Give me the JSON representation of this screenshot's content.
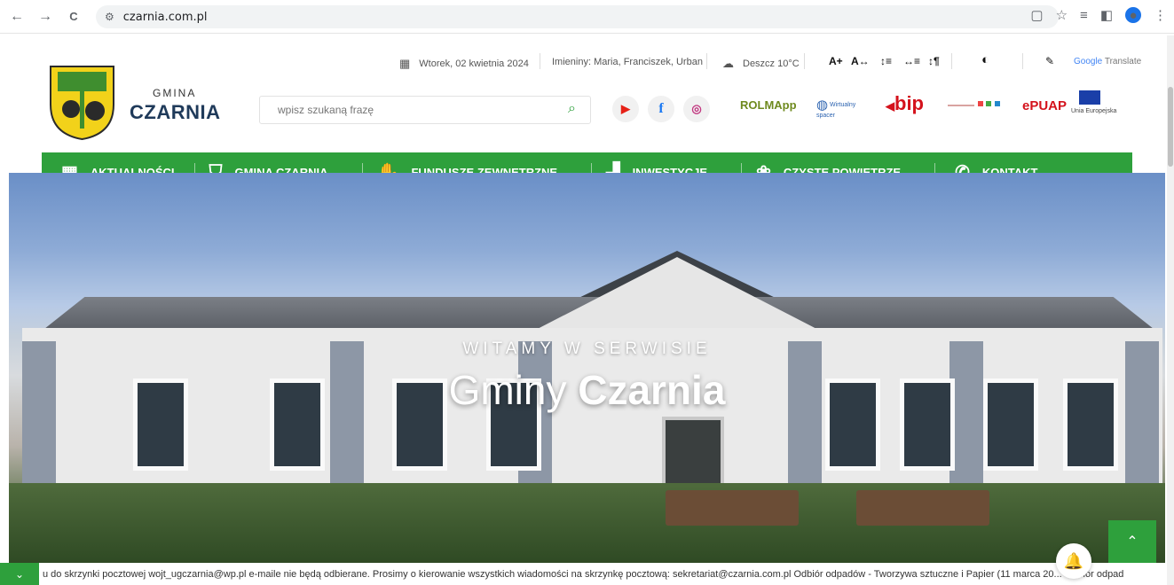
{
  "browser": {
    "back": "←",
    "forward": "→",
    "reload": "C",
    "url": "czarnia.com.pl",
    "bookmark": "☆",
    "profile": "●"
  },
  "site": {
    "logo_small": "GMINA",
    "logo_big": "CZARNIA",
    "date": "Wtorek, 02 kwietnia 2024",
    "nameday": "Imieniny: Maria, Franciszek, Urban",
    "weather": "Deszcz 10°C",
    "font_larger": "A+",
    "font_spacing": "A↔",
    "translate_prefix": "Google",
    "translate_word": "Translate",
    "search_placeholder": "wpisz szukaną frazę",
    "partners": {
      "rolmapp": "ROLMApp",
      "wirtualny": "Wirtualny spacer",
      "bip": "bip",
      "epuap": "ePUAP",
      "eu": "Unia Europejska"
    }
  },
  "nav": [
    {
      "label": "AKTUALNOŚCI",
      "icon": "calendar-icon",
      "chevron": false
    },
    {
      "label": "GMINA CZARNIA",
      "icon": "shield-check-icon",
      "chevron": true
    },
    {
      "label": "FUNDUSZE ZEWNĘTRZNE",
      "icon": "handshake-icon",
      "chevron": true
    },
    {
      "label": "INWESTYCJE",
      "icon": "growth-chart-icon",
      "chevron": true
    },
    {
      "label": "CZYSTE POWIETRZE",
      "icon": "leaf-icon",
      "chevron": true
    },
    {
      "label": "KONTAKT",
      "icon": "phone-icon",
      "chevron": false
    }
  ],
  "hero": {
    "subtitle": "WITAMY W SERWISIE",
    "title_light": "Gminy ",
    "title_bold": "Czarnia"
  },
  "ticker": {
    "text": "u do skrzynki pocztowej wojt_ugczarnia@wp.pl e-maile nie będą odbierane. Prosimy o kierowanie wszystkich wiadomości na skrzynkę pocztową: sekretariat@czarnia.com.pl       Odbiór odpadów - Tworzywa sztuczne i Papier (11 marca 20...       Odbiór odpad"
  },
  "colors": {
    "brand_green": "#2ea03c",
    "logo_blue": "#1f3a5a"
  }
}
